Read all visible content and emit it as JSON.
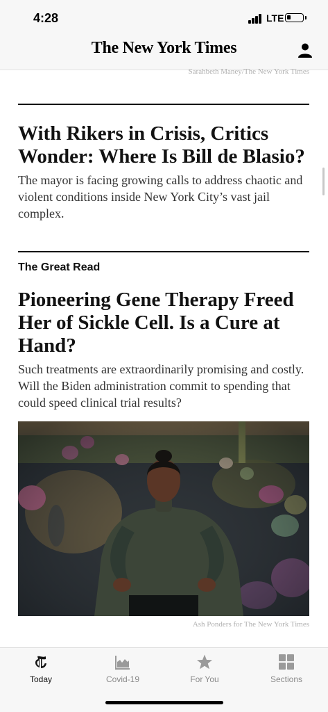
{
  "status_bar": {
    "time": "4:28",
    "network": "LTE"
  },
  "header": {
    "masthead": "The New York Times",
    "user_icon": "account-icon"
  },
  "top_photo_credit": "Sarahbeth Maney/The New York Times",
  "articles": [
    {
      "headline": "With Rikers in Crisis, Critics Wonder: Where Is Bill de Blasio?",
      "summary": "The mayor is facing growing calls to address chaotic and violent conditions inside New York City’s vast jail complex."
    },
    {
      "kicker": "The Great Read",
      "headline": "Pioneering Gene Therapy Freed Her of Sickle Cell. Is a Cure at Hand?",
      "summary": "Such treatments are extraordinarily promising and costly. Will the Biden administration commit to spending that could speed clinical trial results?",
      "photo_credit": "Ash Ponders for The New York Times"
    }
  ],
  "tab_bar": {
    "tabs": [
      {
        "label": "Today",
        "icon": "nyt-logo-icon",
        "active": true
      },
      {
        "label": "Covid-19",
        "icon": "chart-icon",
        "active": false
      },
      {
        "label": "For You",
        "icon": "star-icon",
        "active": false
      },
      {
        "label": "Sections",
        "icon": "grid-icon",
        "active": false
      }
    ]
  },
  "colors": {
    "text": "#121212",
    "inactive": "#8a8a8a",
    "bar_bg": "#f7f7f7"
  }
}
